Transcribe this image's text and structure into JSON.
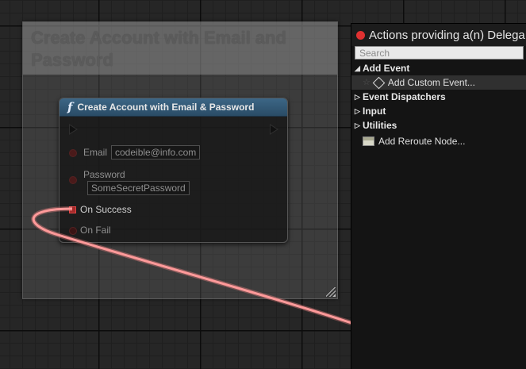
{
  "comment": {
    "title": "Create Account with Email and Password"
  },
  "node": {
    "title": "Create Account with Email & Password",
    "func_icon": "f",
    "pins": {
      "email_label": "Email",
      "email_value": "codeible@info.com",
      "password_label": "Password",
      "password_value": "SomeSecretPassword",
      "on_success": "On Success",
      "on_fail": "On Fail"
    }
  },
  "wire": {
    "color": "#ff8a8a"
  },
  "actions_panel": {
    "title": "Actions providing a(n) Delega",
    "search_placeholder": "Search",
    "categories": [
      {
        "label": "Add Event",
        "expanded": true,
        "items": [
          {
            "label": "Add Custom Event...",
            "icon": "custom-event-icon"
          }
        ]
      },
      {
        "label": "Event Dispatchers",
        "expanded": false
      },
      {
        "label": "Input",
        "expanded": false
      },
      {
        "label": "Utilities",
        "expanded": false
      }
    ],
    "reroute": {
      "label": "Add Reroute Node...",
      "icon": "reroute-node-icon"
    }
  }
}
